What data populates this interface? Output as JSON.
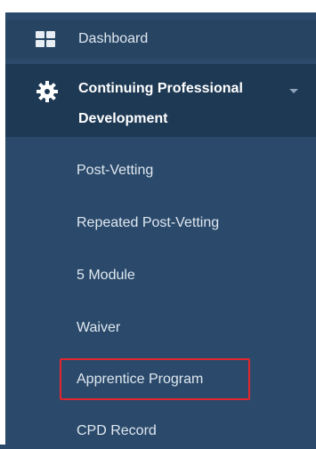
{
  "sidebar": {
    "accent_color": "#2b4a6b",
    "highlight_color": "#e3262e",
    "dashboard": {
      "label": "Dashboard",
      "icon": "dashboard-grid-icon"
    },
    "cpd": {
      "label": "Continuing Professional Development",
      "icon": "gear-icon",
      "expanded": true
    },
    "sub_items": [
      {
        "label": "Post-Vetting"
      },
      {
        "label": "Repeated Post-Vetting"
      },
      {
        "label": "5 Module"
      },
      {
        "label": "Waiver"
      },
      {
        "label": "Apprentice Program",
        "highlighted": true
      },
      {
        "label": "CPD Record"
      }
    ]
  }
}
